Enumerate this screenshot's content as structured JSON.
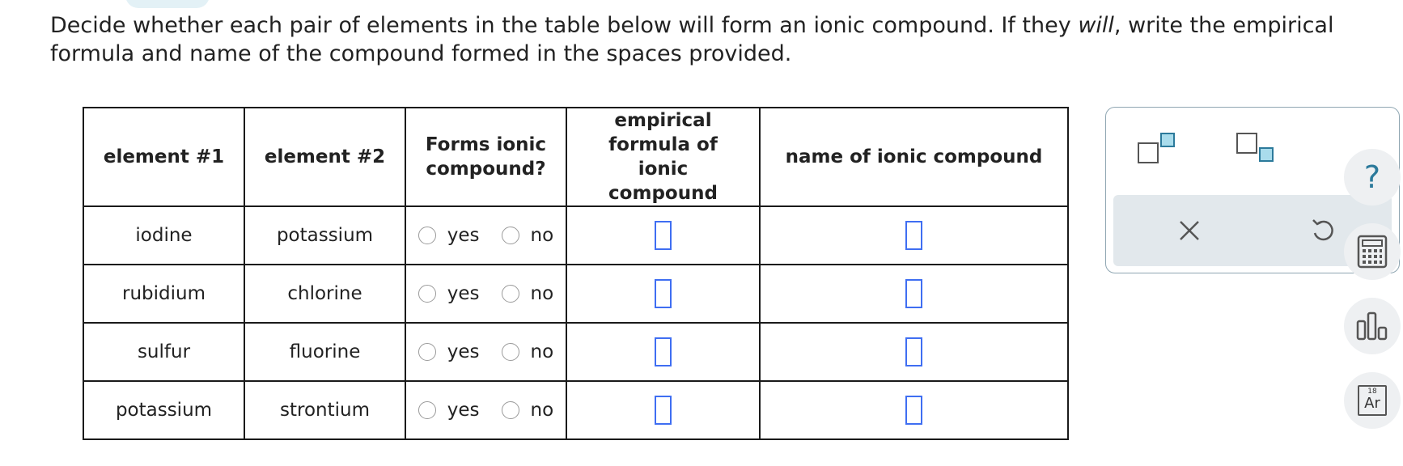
{
  "instructions": {
    "part1": "Decide whether each pair of elements in the table below will form an ionic compound. If they ",
    "emphasis": "will",
    "part2": ", write the empirical formula and name of the compound formed in the spaces provided."
  },
  "table": {
    "headers": {
      "element1": "element #1",
      "element2": "element #2",
      "forms_ionic": "Forms ionic compound?",
      "formula": "empirical formula of ionic compound",
      "name": "name of ionic compound"
    },
    "rows": [
      {
        "element1": "iodine",
        "element2": "potassium",
        "yes_label": "yes",
        "no_label": "no",
        "formula": "",
        "name": ""
      },
      {
        "element1": "rubidium",
        "element2": "chlorine",
        "yes_label": "yes",
        "no_label": "no",
        "formula": "",
        "name": ""
      },
      {
        "element1": "sulfur",
        "element2": "fluorine",
        "yes_label": "yes",
        "no_label": "no",
        "formula": "",
        "name": ""
      },
      {
        "element1": "potassium",
        "element2": "strontium",
        "yes_label": "yes",
        "no_label": "no",
        "formula": "",
        "name": ""
      }
    ]
  },
  "tools": {
    "superscript_icon": "superscript-icon",
    "subscript_icon": "subscript-icon",
    "clear_icon": "close-icon",
    "undo_icon": "undo-icon"
  },
  "sidebar": {
    "help": "?",
    "periodic_number": "18",
    "periodic_symbol": "Ar"
  },
  "colors": {
    "answer_box_border": "#3f6ef2",
    "tool_accent": "#2c7a9b",
    "tool_fill": "#a9dcec",
    "action_row_bg": "#e2e8ec"
  }
}
